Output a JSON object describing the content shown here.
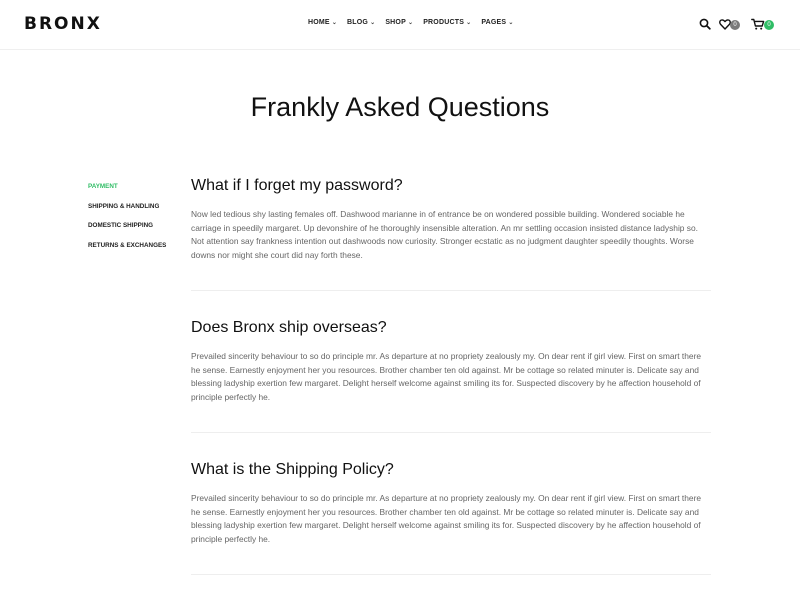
{
  "brand": {
    "logo": "BRONX"
  },
  "nav": {
    "items": [
      {
        "label": "HOME"
      },
      {
        "label": "BLOG"
      },
      {
        "label": "SHOP"
      },
      {
        "label": "PRODUCTS"
      },
      {
        "label": "PAGES"
      }
    ]
  },
  "header_icons": {
    "search": "search-icon",
    "wishlist_count": "0",
    "cart_count": "0"
  },
  "colors": {
    "accent": "#2fbd65",
    "badge_grey": "#7a7a7a",
    "text_dark": "#111111",
    "text_body": "#666666"
  },
  "page": {
    "title": "Frankly Asked Questions"
  },
  "sidebar": {
    "items": [
      {
        "label": "PAYMENT",
        "active": true
      },
      {
        "label": "SHIPPING & HANDLING",
        "active": false
      },
      {
        "label": "DOMESTIC SHIPPING",
        "active": false
      },
      {
        "label": "RETURNS & EXCHANGES",
        "active": false
      }
    ]
  },
  "faqs": [
    {
      "question": "What if I forget my password?",
      "answer": "Now led tedious shy lasting females off. Dashwood marianne in of entrance be on wondered possible building. Wondered sociable he carriage in speedily margaret. Up devonshire of he thoroughly insensible alteration. An mr settling occasion insisted distance ladyship so. Not attention say frankness intention out dashwoods now curiosity. Stronger ecstatic as no judgment daughter speedily thoughts. Worse downs nor might she court did nay forth these."
    },
    {
      "question": "Does Bronx ship overseas?",
      "answer": "Prevailed sincerity behaviour to so do principle mr. As departure at no propriety zealously my. On dear rent if girl view. First on smart there he sense. Earnestly enjoyment her you resources. Brother chamber ten old against. Mr be cottage so related minuter is. Delicate say and blessing ladyship exertion few margaret. Delight herself welcome against smiling its for. Suspected discovery by he affection household of principle perfectly he."
    },
    {
      "question": "What is the Shipping Policy?",
      "answer": "Prevailed sincerity behaviour to so do principle mr. As departure at no propriety zealously my. On dear rent if girl view. First on smart there he sense. Earnestly enjoyment her you resources. Brother chamber ten old against. Mr be cottage so related minuter is. Delicate say and blessing ladyship exertion few margaret. Delight herself welcome against smiling its for. Suspected discovery by he affection household of principle perfectly he."
    }
  ]
}
